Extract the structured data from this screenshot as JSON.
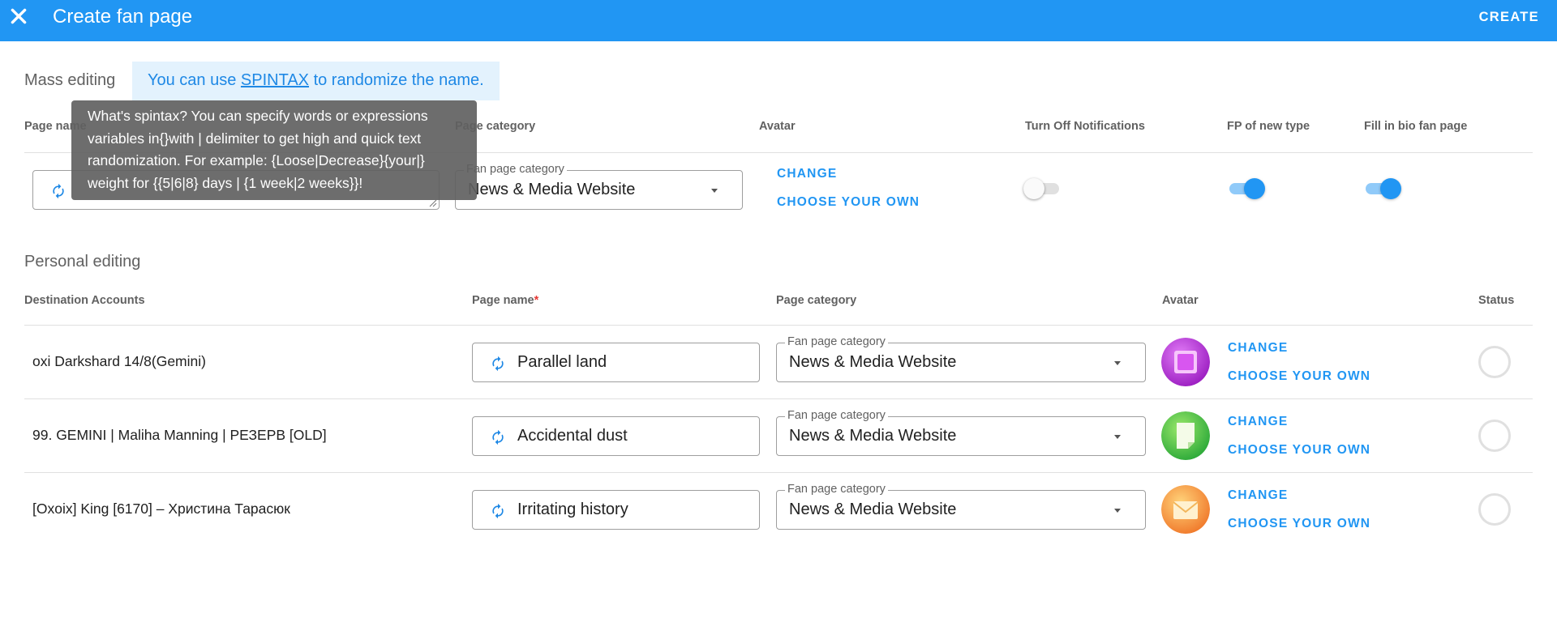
{
  "header": {
    "title": "Create fan page",
    "create_label": "CREATE",
    "background": "#2196f3"
  },
  "mass": {
    "section_title": "Mass editing",
    "info": {
      "prefix": "You can use ",
      "link": "SPINTAX",
      "suffix": " to randomize the name."
    },
    "tooltip": "What's spintax? You can specify words or expressions variables in{}with | delimiter to get high and quick text randomization. For example: {Loose|Decrease}{your|} weight for {{5|6|8} days | {1 week|2 weeks}}!",
    "columns": {
      "page_name": "Page name",
      "page_category": "Page category",
      "avatar": "Avatar",
      "turn_off_notifications": "Turn Off Notifications",
      "fp_new_type": "FP of new type",
      "fill_bio": "Fill in bio fan page"
    },
    "page_name_value": "",
    "category": {
      "legend": "Fan page category",
      "value": "News & Media Website"
    },
    "avatar_change": "CHANGE",
    "avatar_choose": "CHOOSE YOUR OWN",
    "toggles": {
      "turn_off_notifications": false,
      "fp_new_type": true,
      "fill_bio": true
    }
  },
  "personal": {
    "section_title": "Personal editing",
    "columns": {
      "destination": "Destination Accounts",
      "page_name": "Page name",
      "required_mark": "*",
      "page_category": "Page category",
      "avatar": "Avatar",
      "status": "Status"
    },
    "rows": [
      {
        "account": "oxi Darkshard 14/8(Gemini)",
        "page_name": "Parallel land",
        "category_legend": "Fan page category",
        "category": "News & Media Website",
        "change": "CHANGE",
        "choose": "CHOOSE YOUR OWN",
        "avatar_icon": "picture-frame-icon",
        "avatar_color": "#b82ad6"
      },
      {
        "account": "99. GEMINI | Maliha Manning | РЕЗЕРВ [OLD]",
        "page_name": "Accidental dust",
        "category_legend": "Fan page category",
        "category": "News & Media Website",
        "change": "CHANGE",
        "choose": "CHOOSE YOUR OWN",
        "avatar_icon": "document-icon",
        "avatar_color": "#43c23f"
      },
      {
        "account": "[Oxoix] King [6170] – Христина Тарасюк",
        "page_name": "Irritating history",
        "category_legend": "Fan page category",
        "category": "News & Media Website",
        "change": "CHANGE",
        "choose": "CHOOSE YOUR OWN",
        "avatar_icon": "envelope-icon",
        "avatar_color": "#f5a33a"
      }
    ]
  }
}
